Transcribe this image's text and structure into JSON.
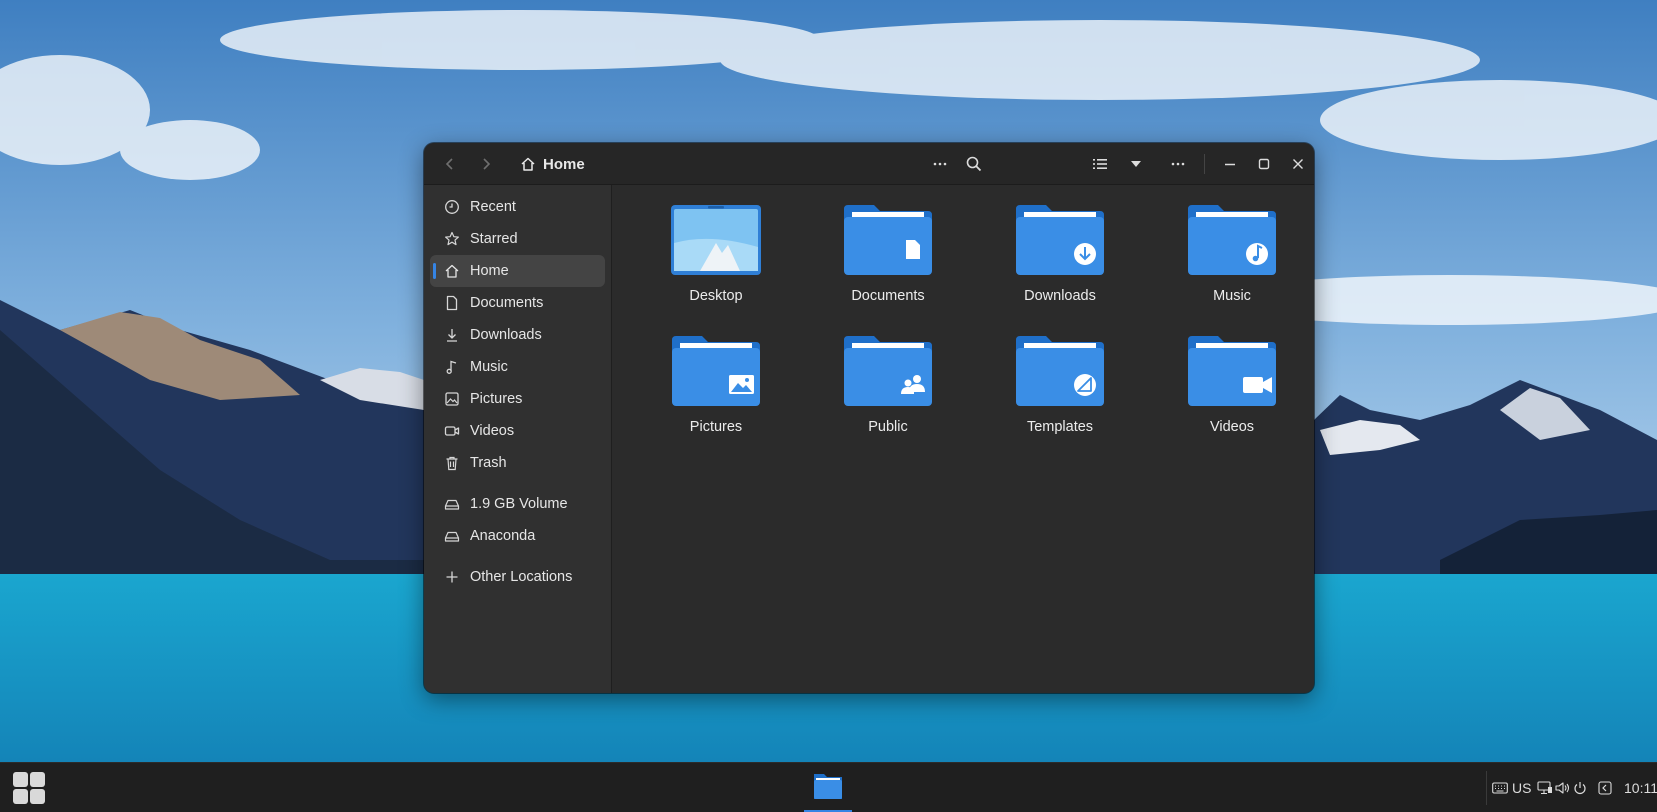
{
  "window": {
    "location_title": "Home",
    "header_icons": [
      "back-icon",
      "forward-icon",
      "home-icon",
      "more-icon",
      "search-icon",
      "list-view-icon",
      "view-options-icon",
      "menu-icon",
      "minimize-icon",
      "maximize-icon",
      "close-icon"
    ]
  },
  "sidebar": {
    "places": [
      {
        "label": "Recent",
        "icon": "clock-icon"
      },
      {
        "label": "Starred",
        "icon": "star-icon"
      },
      {
        "label": "Home",
        "icon": "home-icon",
        "active": true
      },
      {
        "label": "Documents",
        "icon": "document-icon"
      },
      {
        "label": "Downloads",
        "icon": "download-icon"
      },
      {
        "label": "Music",
        "icon": "music-icon"
      },
      {
        "label": "Pictures",
        "icon": "picture-icon"
      },
      {
        "label": "Videos",
        "icon": "video-icon"
      },
      {
        "label": "Trash",
        "icon": "trash-icon"
      }
    ],
    "devices": [
      {
        "label": "1.9 GB Volume",
        "icon": "drive-icon"
      },
      {
        "label": "Anaconda",
        "icon": "drive-icon"
      }
    ],
    "other": {
      "label": "Other Locations",
      "icon": "plus-icon"
    }
  },
  "files": [
    {
      "label": "Desktop",
      "icon": "desktop-folder-icon"
    },
    {
      "label": "Documents",
      "icon": "documents-folder-icon"
    },
    {
      "label": "Downloads",
      "icon": "downloads-folder-icon"
    },
    {
      "label": "Music",
      "icon": "music-folder-icon"
    },
    {
      "label": "Pictures",
      "icon": "pictures-folder-icon"
    },
    {
      "label": "Public",
      "icon": "public-folder-icon"
    },
    {
      "label": "Templates",
      "icon": "templates-folder-icon"
    },
    {
      "label": "Videos",
      "icon": "videos-folder-icon"
    }
  ],
  "taskbar": {
    "keyboard_layout": "US",
    "clock": "10:11"
  },
  "colors": {
    "accent": "#3584e4",
    "folder": "#3a8ee6",
    "window_bg": "#2b2b2b",
    "sidebar_bg": "#303030"
  }
}
